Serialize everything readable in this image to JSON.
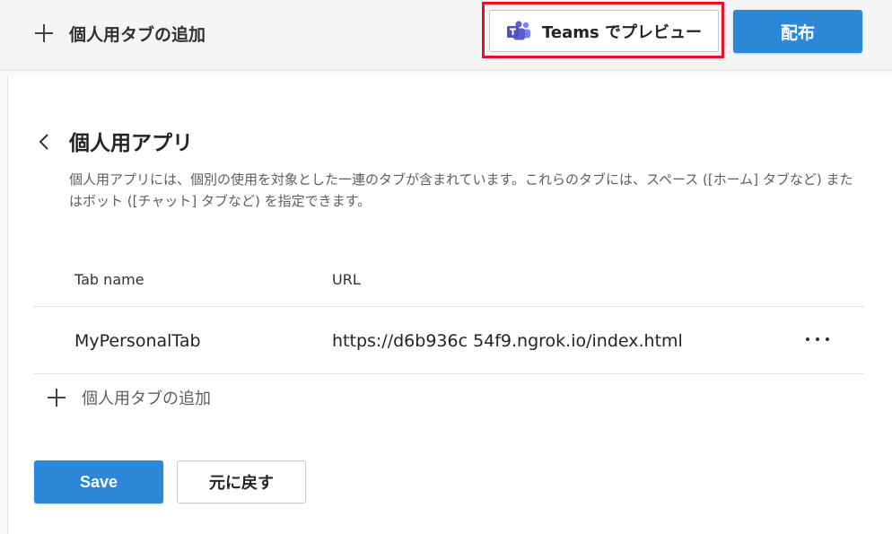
{
  "topbar": {
    "add_label": "個人用タブの追加",
    "teams_preview_label": "Teams でプレビュー",
    "publish_label": "配布"
  },
  "page": {
    "title": "個人用アプリ",
    "description": "個人用アプリには、個別の使用を対象とした一連のタブが含まれています。これらのタブには、スペース ([ホーム] タブなど) またはボット ([チャット] タブなど) を指定できます。"
  },
  "table": {
    "headers": [
      "Tab name",
      "URL"
    ],
    "rows": [
      {
        "name": "MyPersonalTab",
        "url": "https://d6b936c 54f9.ngrok.io/index.html"
      }
    ],
    "add_label": "個人用タブの追加"
  },
  "actions": {
    "save_label": "Save",
    "revert_label": "元に戻す"
  },
  "colors": {
    "accent": "#2b88d8",
    "highlight": "#e81123",
    "teams_purple": "#5b5fc7"
  },
  "icons": {
    "add": "plus-icon",
    "teams": "teams-icon",
    "back": "chevron-left-icon",
    "more": "more-icon"
  }
}
